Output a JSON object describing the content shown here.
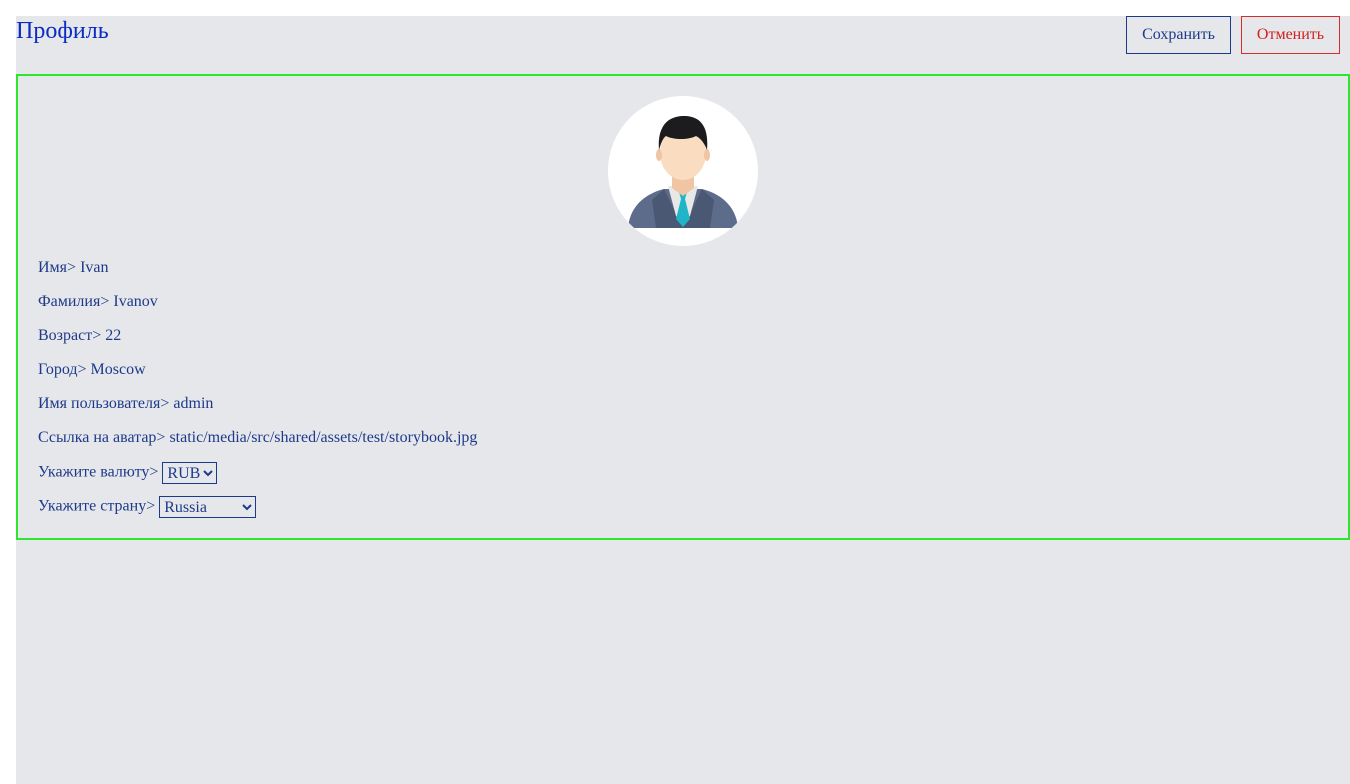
{
  "header": {
    "title": "Профиль",
    "save_label": "Сохранить",
    "cancel_label": "Отменить"
  },
  "profile": {
    "avatar_icon": "user-avatar-icon",
    "fields": {
      "first_name": {
        "label": "Имя>",
        "value": "Ivan"
      },
      "last_name": {
        "label": "Фамилия>",
        "value": "Ivanov"
      },
      "age": {
        "label": "Возраст>",
        "value": "22"
      },
      "city": {
        "label": "Город>",
        "value": "Moscow"
      },
      "username": {
        "label": "Имя пользователя>",
        "value": "admin"
      },
      "avatar_link": {
        "label": "Ссылка на аватар>",
        "value": "static/media/src/shared/assets/test/storybook.jpg"
      },
      "currency": {
        "label": "Укажите валюту>",
        "value": "RUB"
      },
      "country": {
        "label": "Укажите страну>",
        "value": "Russia"
      }
    }
  },
  "colors": {
    "accent": "#0b2cc4",
    "text": "#1d3a8a",
    "cancel": "#d21f1f",
    "card_border": "#2ee62e",
    "background": "#e6e7ea"
  }
}
